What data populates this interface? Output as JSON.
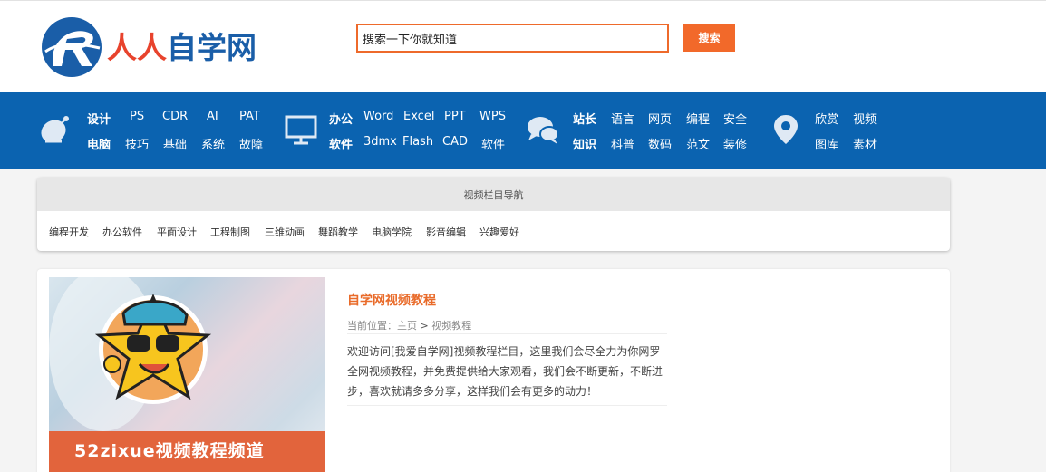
{
  "header": {
    "logo_text_red": "人人",
    "logo_text_blue": "自学网",
    "search_placeholder": "搜索一下你就知道",
    "search_button": "搜索"
  },
  "nav": {
    "groups": [
      {
        "icon": "satellite-dish-icon",
        "row1": [
          "设计",
          "PS",
          "CDR",
          "AI",
          "PAT"
        ],
        "row2": [
          "电脑",
          "技巧",
          "基础",
          "系统",
          "故障"
        ]
      },
      {
        "icon": "presentation-screen-icon",
        "row1": [
          "办公",
          "Word",
          "Excel",
          "PPT",
          "WPS"
        ],
        "row2": [
          "软件",
          "3dmx",
          "Flash",
          "CAD",
          "软件"
        ]
      },
      {
        "icon": "chat-bubbles-icon",
        "row1": [
          "站长",
          "语言",
          "网页",
          "编程",
          "安全"
        ],
        "row2": [
          "知识",
          "科普",
          "数码",
          "范文",
          "装修"
        ]
      },
      {
        "icon": "location-pin-icon",
        "row1": [
          "欣赏",
          "视频"
        ],
        "row2": [
          "图库",
          "素材"
        ]
      }
    ]
  },
  "column_nav": {
    "title": "视频栏目导航",
    "links": [
      "编程开发",
      "办公软件",
      "平面设计",
      "工程制图",
      "三维动画",
      "舞蹈教学",
      "电脑学院",
      "影音编辑",
      "兴趣爱好"
    ]
  },
  "content": {
    "banner_title": "52zixue视频教程频道",
    "title": "自学网视频教程",
    "breadcrumb_prefix": "当前位置：",
    "breadcrumb_home": "主页",
    "breadcrumb_sep": ">",
    "breadcrumb_current": "视频教程",
    "description": "欢迎访问[我爱自学网]视频教程栏目，这里我们会尽全力为你网罗全网视频教程，并免费提供给大家观看，我们会不断更新，不断进步，喜欢就请多多分享，这样我们会有更多的动力！"
  },
  "colors": {
    "accent_orange": "#f2692a",
    "nav_blue": "#0b63b0",
    "logo_red": "#e8432d",
    "logo_blue": "#1a5ea8"
  }
}
